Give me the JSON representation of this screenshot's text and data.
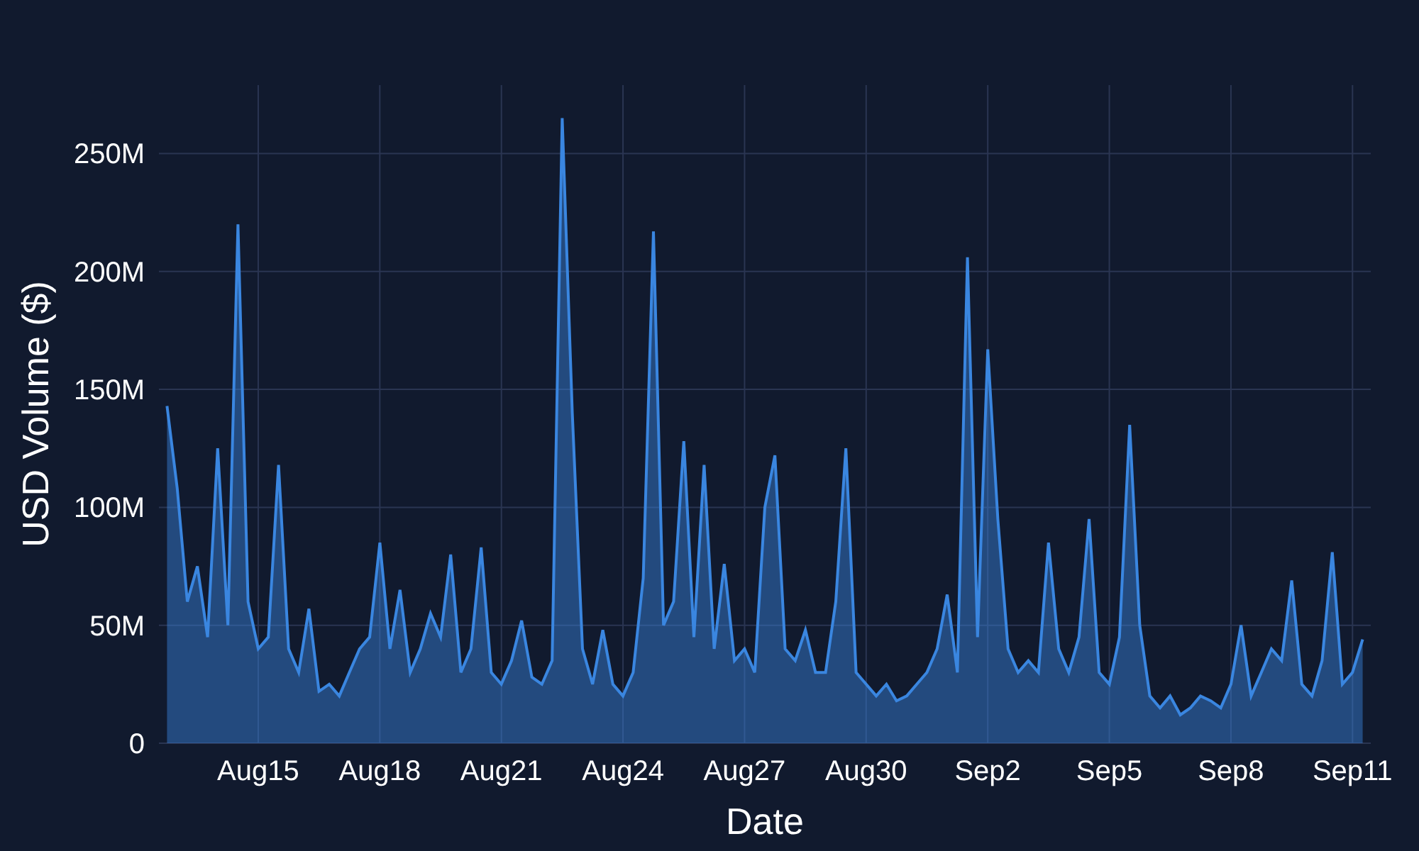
{
  "chart_data": {
    "type": "area",
    "xlabel": "Date",
    "ylabel": "USD Volume ($)",
    "grid": true,
    "ylim": [
      0,
      279
    ],
    "yticks": [
      {
        "value": 0,
        "label": "0"
      },
      {
        "value": 50,
        "label": "50M"
      },
      {
        "value": 100,
        "label": "100M"
      },
      {
        "value": 150,
        "label": "150M"
      },
      {
        "value": 200,
        "label": "200M"
      },
      {
        "value": 250,
        "label": "250M"
      }
    ],
    "categories": [
      null,
      null,
      null,
      null,
      null,
      null,
      null,
      null,
      null,
      "Aug15",
      null,
      null,
      null,
      null,
      null,
      null,
      null,
      null,
      null,
      null,
      null,
      "Aug18",
      null,
      null,
      null,
      null,
      null,
      null,
      null,
      null,
      null,
      null,
      null,
      "Aug21",
      null,
      null,
      null,
      null,
      null,
      null,
      null,
      null,
      null,
      null,
      null,
      "Aug24",
      null,
      null,
      null,
      null,
      null,
      null,
      null,
      null,
      null,
      null,
      null,
      "Aug27",
      null,
      null,
      null,
      null,
      null,
      null,
      null,
      null,
      null,
      null,
      null,
      "Aug30",
      null,
      null,
      null,
      null,
      null,
      null,
      null,
      null,
      null,
      null,
      null,
      "Sep2",
      null,
      null,
      null,
      null,
      null,
      null,
      null,
      null,
      null,
      null,
      null,
      "Sep5",
      null,
      null,
      null,
      null,
      null,
      null,
      null,
      null,
      null,
      null,
      null,
      "Sep8",
      null,
      null,
      null,
      null,
      null,
      null,
      null,
      null,
      null,
      null,
      null,
      "Sep11",
      null
    ],
    "series": [
      {
        "color": "#3a86e0",
        "values": [
          143,
          108,
          60,
          75,
          45,
          125,
          50,
          220,
          60,
          40,
          45,
          118,
          40,
          30,
          57,
          22,
          25,
          20,
          30,
          40,
          45,
          85,
          40,
          65,
          30,
          40,
          55,
          45,
          80,
          30,
          40,
          83,
          30,
          25,
          35,
          52,
          28,
          25,
          35,
          265,
          140,
          40,
          25,
          48,
          25,
          20,
          30,
          70,
          217,
          50,
          60,
          128,
          45,
          118,
          40,
          76,
          35,
          40,
          30,
          100,
          122,
          40,
          35,
          48,
          30,
          30,
          60,
          125,
          30,
          25,
          20,
          25,
          18,
          20,
          25,
          30,
          40,
          63,
          30,
          206,
          45,
          167,
          95,
          40,
          30,
          35,
          30,
          85,
          40,
          30,
          45,
          95,
          30,
          25,
          45,
          135,
          50,
          20,
          15,
          20,
          12,
          15,
          20,
          18,
          15,
          25,
          50,
          20,
          30,
          40,
          35,
          69,
          25,
          20,
          35,
          81,
          25,
          30,
          44
        ]
      }
    ]
  }
}
